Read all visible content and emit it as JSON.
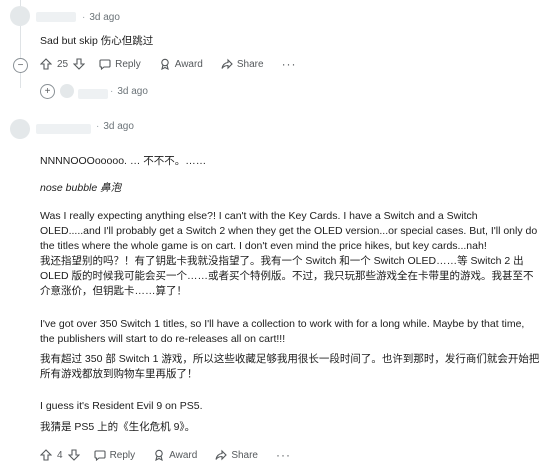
{
  "comment1": {
    "time": "3d ago",
    "text": "Sad but skip  伤心但跳过",
    "actions": {
      "votes": "25",
      "reply": "Reply",
      "award": "Award",
      "share": "Share",
      "more": "···"
    }
  },
  "comment2": {
    "time": "3d ago"
  },
  "comment3": {
    "time": "3d ago",
    "p1": "NNNNOOOooooo. …  不不不。……",
    "p2": "nose bubble  鼻泡",
    "p3": "Was I really expecting anything else?! I can't with the Key Cards. I have a Switch and a Switch OLED.....and I'll probably get a Switch 2 when they get the OLED version...or special cases. But, I'll only do the titles where the whole game is on cart. I don't even mind the price hikes, but key cards...nah!",
    "p4": "我还指望别的吗？！有了钥匙卡我就没指望了。我有一个 Switch 和一个 Switch OLED……等 Switch 2 出 OLED 版的时候我可能会买一个……或者买个特例版。不过，我只玩那些游戏全在卡带里的游戏。我甚至不介意涨价，但钥匙卡……算了！",
    "p5": "I've got over 350 Switch 1 titles, so I'll have a collection to work with for a long while. Maybe by that time, the publishers will start to do re-releases all on cart!!!",
    "p6": "我有超过 350 部 Switch 1 游戏，所以这些收藏足够我用很长一段时间了。也许到那时，发行商们就会开始把所有游戏都放到购物车里再版了！",
    "p7": "I guess it's Resident Evil 9 on PS5.",
    "p8": "我猜是 PS5 上的《生化危机 9》。",
    "actions": {
      "votes": "4",
      "reply": "Reply",
      "award": "Award",
      "share": "Share",
      "more": "···"
    }
  }
}
